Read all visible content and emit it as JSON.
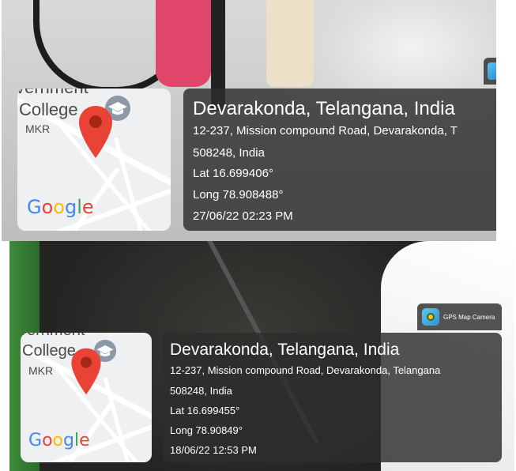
{
  "top": {
    "map": {
      "college": "College",
      "mkr": "MKR",
      "partial": "vernment",
      "logo": "Google"
    },
    "title": "Devarakonda, Telangana, India",
    "address_line1": "12-237, Mission compound Road, Devarakonda, T",
    "address_line2": "508248, India",
    "lat": "Lat 16.699406°",
    "long": "Long 78.908488°",
    "datetime": "27/06/22 02:23 PM"
  },
  "bottom": {
    "map": {
      "college": "College",
      "mkr": "MKR",
      "partial": "vernment",
      "logo": "Google"
    },
    "badge_label": "GPS Map Camera",
    "title": "Devarakonda, Telangana, India",
    "address_line1": "12-237, Mission compound Road, Devarakonda, Telangana",
    "address_line2": "508248, India",
    "lat": "Lat 16.699455°",
    "long": "Long 78.90849°",
    "datetime": "18/06/22 12:53 PM"
  },
  "colors": {
    "panel_bg": "#2d2d2d",
    "pin_red": "#EA4335",
    "google_blue": "#4285F4",
    "google_red": "#EA4335",
    "google_yellow": "#FBBC05",
    "google_green": "#34A853"
  },
  "icons": [
    "map-pin-icon",
    "graduation-cap-icon",
    "gps-map-camera-icon"
  ]
}
